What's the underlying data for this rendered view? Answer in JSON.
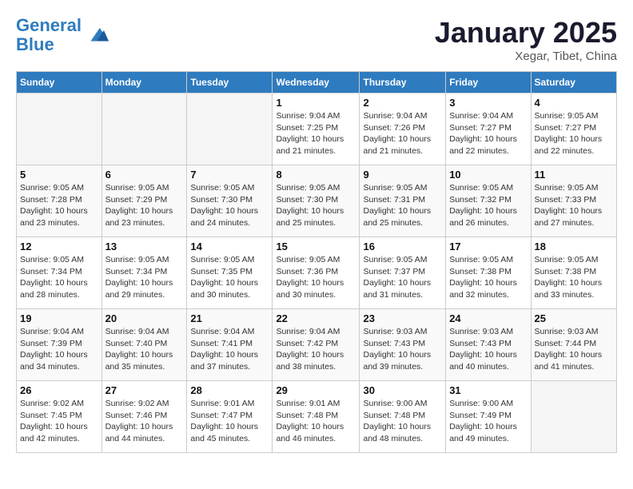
{
  "header": {
    "logo_line1": "General",
    "logo_line2": "Blue",
    "month_title": "January 2025",
    "location": "Xegar, Tibet, China"
  },
  "weekdays": [
    "Sunday",
    "Monday",
    "Tuesday",
    "Wednesday",
    "Thursday",
    "Friday",
    "Saturday"
  ],
  "weeks": [
    [
      {
        "day": "",
        "info": ""
      },
      {
        "day": "",
        "info": ""
      },
      {
        "day": "",
        "info": ""
      },
      {
        "day": "1",
        "info": "Sunrise: 9:04 AM\nSunset: 7:25 PM\nDaylight: 10 hours\nand 21 minutes."
      },
      {
        "day": "2",
        "info": "Sunrise: 9:04 AM\nSunset: 7:26 PM\nDaylight: 10 hours\nand 21 minutes."
      },
      {
        "day": "3",
        "info": "Sunrise: 9:04 AM\nSunset: 7:27 PM\nDaylight: 10 hours\nand 22 minutes."
      },
      {
        "day": "4",
        "info": "Sunrise: 9:05 AM\nSunset: 7:27 PM\nDaylight: 10 hours\nand 22 minutes."
      }
    ],
    [
      {
        "day": "5",
        "info": "Sunrise: 9:05 AM\nSunset: 7:28 PM\nDaylight: 10 hours\nand 23 minutes."
      },
      {
        "day": "6",
        "info": "Sunrise: 9:05 AM\nSunset: 7:29 PM\nDaylight: 10 hours\nand 23 minutes."
      },
      {
        "day": "7",
        "info": "Sunrise: 9:05 AM\nSunset: 7:30 PM\nDaylight: 10 hours\nand 24 minutes."
      },
      {
        "day": "8",
        "info": "Sunrise: 9:05 AM\nSunset: 7:30 PM\nDaylight: 10 hours\nand 25 minutes."
      },
      {
        "day": "9",
        "info": "Sunrise: 9:05 AM\nSunset: 7:31 PM\nDaylight: 10 hours\nand 25 minutes."
      },
      {
        "day": "10",
        "info": "Sunrise: 9:05 AM\nSunset: 7:32 PM\nDaylight: 10 hours\nand 26 minutes."
      },
      {
        "day": "11",
        "info": "Sunrise: 9:05 AM\nSunset: 7:33 PM\nDaylight: 10 hours\nand 27 minutes."
      }
    ],
    [
      {
        "day": "12",
        "info": "Sunrise: 9:05 AM\nSunset: 7:34 PM\nDaylight: 10 hours\nand 28 minutes."
      },
      {
        "day": "13",
        "info": "Sunrise: 9:05 AM\nSunset: 7:34 PM\nDaylight: 10 hours\nand 29 minutes."
      },
      {
        "day": "14",
        "info": "Sunrise: 9:05 AM\nSunset: 7:35 PM\nDaylight: 10 hours\nand 30 minutes."
      },
      {
        "day": "15",
        "info": "Sunrise: 9:05 AM\nSunset: 7:36 PM\nDaylight: 10 hours\nand 30 minutes."
      },
      {
        "day": "16",
        "info": "Sunrise: 9:05 AM\nSunset: 7:37 PM\nDaylight: 10 hours\nand 31 minutes."
      },
      {
        "day": "17",
        "info": "Sunrise: 9:05 AM\nSunset: 7:38 PM\nDaylight: 10 hours\nand 32 minutes."
      },
      {
        "day": "18",
        "info": "Sunrise: 9:05 AM\nSunset: 7:38 PM\nDaylight: 10 hours\nand 33 minutes."
      }
    ],
    [
      {
        "day": "19",
        "info": "Sunrise: 9:04 AM\nSunset: 7:39 PM\nDaylight: 10 hours\nand 34 minutes."
      },
      {
        "day": "20",
        "info": "Sunrise: 9:04 AM\nSunset: 7:40 PM\nDaylight: 10 hours\nand 35 minutes."
      },
      {
        "day": "21",
        "info": "Sunrise: 9:04 AM\nSunset: 7:41 PM\nDaylight: 10 hours\nand 37 minutes."
      },
      {
        "day": "22",
        "info": "Sunrise: 9:04 AM\nSunset: 7:42 PM\nDaylight: 10 hours\nand 38 minutes."
      },
      {
        "day": "23",
        "info": "Sunrise: 9:03 AM\nSunset: 7:43 PM\nDaylight: 10 hours\nand 39 minutes."
      },
      {
        "day": "24",
        "info": "Sunrise: 9:03 AM\nSunset: 7:43 PM\nDaylight: 10 hours\nand 40 minutes."
      },
      {
        "day": "25",
        "info": "Sunrise: 9:03 AM\nSunset: 7:44 PM\nDaylight: 10 hours\nand 41 minutes."
      }
    ],
    [
      {
        "day": "26",
        "info": "Sunrise: 9:02 AM\nSunset: 7:45 PM\nDaylight: 10 hours\nand 42 minutes."
      },
      {
        "day": "27",
        "info": "Sunrise: 9:02 AM\nSunset: 7:46 PM\nDaylight: 10 hours\nand 44 minutes."
      },
      {
        "day": "28",
        "info": "Sunrise: 9:01 AM\nSunset: 7:47 PM\nDaylight: 10 hours\nand 45 minutes."
      },
      {
        "day": "29",
        "info": "Sunrise: 9:01 AM\nSunset: 7:48 PM\nDaylight: 10 hours\nand 46 minutes."
      },
      {
        "day": "30",
        "info": "Sunrise: 9:00 AM\nSunset: 7:48 PM\nDaylight: 10 hours\nand 48 minutes."
      },
      {
        "day": "31",
        "info": "Sunrise: 9:00 AM\nSunset: 7:49 PM\nDaylight: 10 hours\nand 49 minutes."
      },
      {
        "day": "",
        "info": ""
      }
    ]
  ]
}
